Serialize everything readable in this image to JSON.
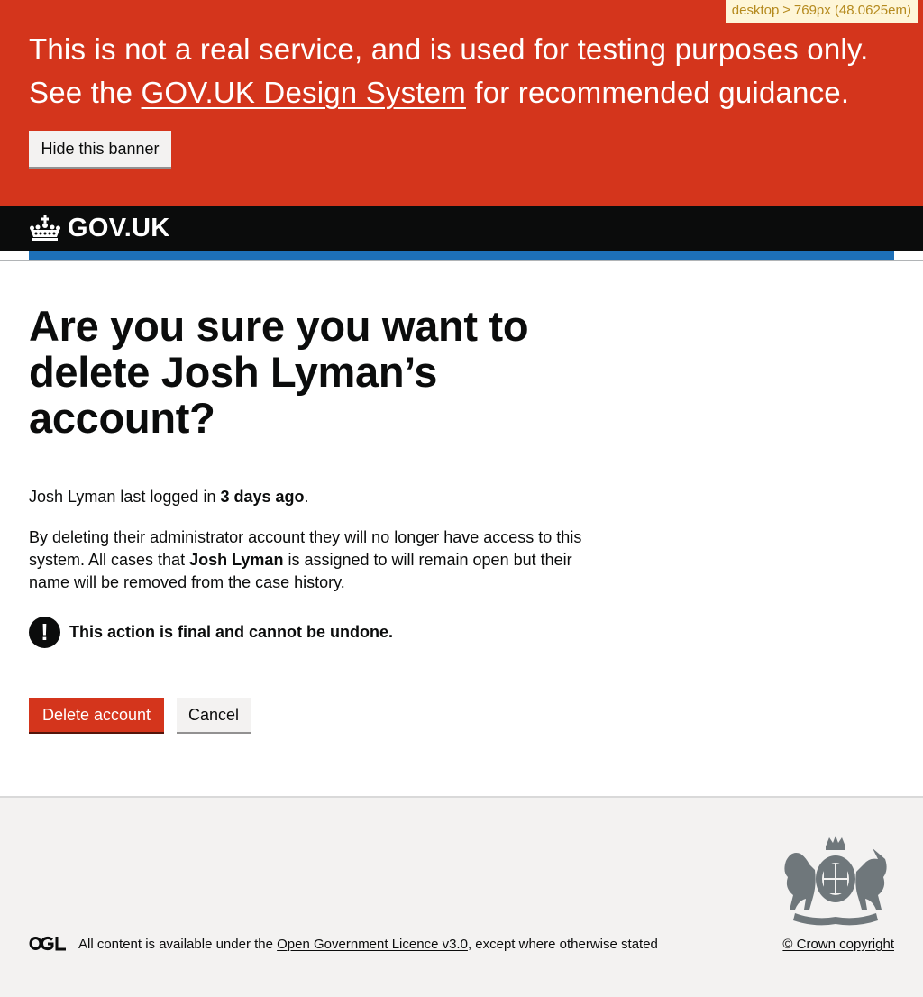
{
  "debug_tag": "desktop ≥ 769px (48.0625em)",
  "banner": {
    "line_prefix": "This is not a real service, and is used for testing purposes only. See the ",
    "link_text": "GOV.UK Design System",
    "line_suffix": " for recommended guidance.",
    "hide_button": "Hide this banner",
    "color": "#d4351c"
  },
  "header": {
    "logo_text": "GOV.UK",
    "logo_icon": "crown-icon",
    "accent_color": "#1d70b8"
  },
  "main": {
    "heading": "Are you sure you want to delete Josh Lyman’s account?",
    "p1_prefix": "Josh Lyman last logged in ",
    "p1_bold": "3 days ago",
    "p1_suffix": ".",
    "p2_prefix": "By deleting their administrator account they will no longer have access to this system. All cases that ",
    "p2_bold": "Josh Lyman",
    "p2_suffix": " is assigned to will remain open but their name will be removed from the case history.",
    "warning_icon_glyph": "!",
    "warning_text": "This action is final and cannot be undone.",
    "delete_button": "Delete account",
    "cancel_button": "Cancel"
  },
  "footer": {
    "ogl_icon": "ogl-logo-icon",
    "licence_prefix": "All content is available under the ",
    "licence_link": "Open Government Licence v3.0",
    "licence_suffix": ", except where otherwise stated",
    "copyright": "© Crown copyright",
    "crest_icon": "royal-coat-of-arms-icon"
  }
}
